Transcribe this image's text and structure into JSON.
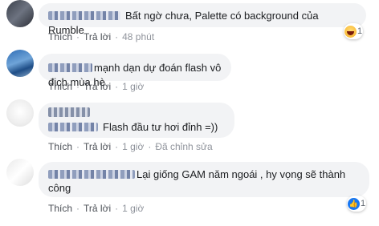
{
  "comments": [
    {
      "text": "Bất ngờ chưa, Palette có background của Rumble",
      "actions": {
        "like": "Thích",
        "reply": "Trả lời",
        "time": "48 phút"
      },
      "reaction": {
        "type": "haha-icon",
        "count": "1"
      }
    },
    {
      "text": "mạnh dạn dự đoán flash vô địch mùa hè",
      "actions": {
        "like": "Thích",
        "reply": "Trả lời",
        "time": "1 giờ"
      }
    },
    {
      "text": "Flash đầu tư hơi đỉnh =))",
      "actions": {
        "like": "Thích",
        "reply": "Trả lời",
        "time": "1 giờ",
        "edited": "Đã chỉnh sửa"
      }
    },
    {
      "text_line1": "Lại giống GAM năm ngoái , hy vọng sẽ thành",
      "text_line2": "công",
      "actions": {
        "like": "Thích",
        "reply": "Trả lời",
        "time": "1 giờ"
      },
      "reaction": {
        "type": "like-icon",
        "count": "1"
      }
    }
  ],
  "colors": {
    "bubble": "#f2f3f5",
    "link": "#4b4f56",
    "meta": "#90949c",
    "like": "#1877f2"
  }
}
